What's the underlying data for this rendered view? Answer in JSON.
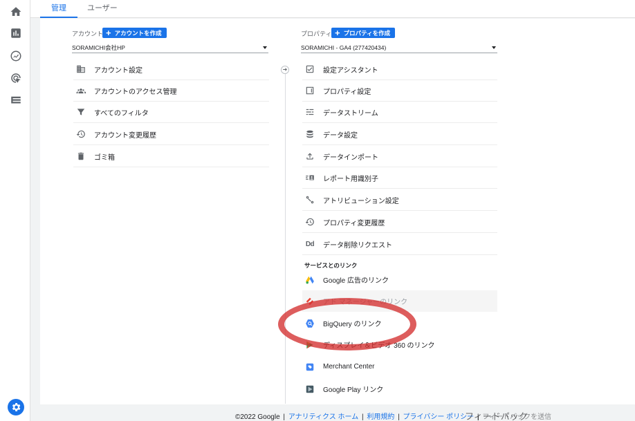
{
  "tabs": [
    {
      "label": "管理"
    },
    {
      "label": "ユーザー"
    }
  ],
  "account": {
    "label": "アカウント",
    "create_label": "アカウントを作成",
    "selected": "SORAMICHI会社HP",
    "items": [
      {
        "label": "アカウント設定",
        "icon": "building-icon"
      },
      {
        "label": "アカウントのアクセス管理",
        "icon": "people-icon"
      },
      {
        "label": "すべてのフィルタ",
        "icon": "filter-icon"
      },
      {
        "label": "アカウント変更履歴",
        "icon": "history-icon"
      },
      {
        "label": "ゴミ箱",
        "icon": "trash-icon"
      }
    ]
  },
  "property": {
    "label": "プロパティ",
    "create_label": "プロパティを作成",
    "selected": "SORAMICHI - GA4 (277420434)",
    "items": [
      {
        "label": "設定アシスタント",
        "icon": "checkbox-icon"
      },
      {
        "label": "プロパティ設定",
        "icon": "property-icon"
      },
      {
        "label": "データストリーム",
        "icon": "stream-icon"
      },
      {
        "label": "データ設定",
        "icon": "database-icon"
      },
      {
        "label": "データインポート",
        "icon": "upload-icon"
      },
      {
        "label": "レポート用識別子",
        "icon": "identity-icon"
      },
      {
        "label": "アトリビューション設定",
        "icon": "attribution-icon"
      },
      {
        "label": "プロパティ変更履歴",
        "icon": "history-icon"
      },
      {
        "label": "データ削除リクエスト",
        "icon": "dd-icon",
        "icon_text": "Dd"
      }
    ],
    "links_heading": "サービスとのリンク",
    "links": [
      {
        "label": "Google 広告のリンク",
        "icon": "google-ads-icon"
      },
      {
        "label": "アド マネージャーのリンク",
        "icon": "ad-manager-icon"
      },
      {
        "label": "BigQuery のリンク",
        "icon": "bigquery-icon"
      },
      {
        "label": "ディスプレイ＆ビデオ 360 のリンク",
        "icon": "display-video-icon"
      },
      {
        "label": "Merchant Center",
        "icon": "merchant-center-icon"
      },
      {
        "label": "Google Play リンク",
        "icon": "google-play-icon"
      }
    ]
  },
  "footer": {
    "copyright": "©2022 Google",
    "links": [
      "アナリティクス ホーム",
      "利用規約",
      "プライバシー ポリシー"
    ],
    "feedback": "フィードバックを送信",
    "overlay_text": "フィードバック"
  },
  "colors": {
    "accent": "#1a73e8",
    "annotation": "#d32f2f"
  }
}
